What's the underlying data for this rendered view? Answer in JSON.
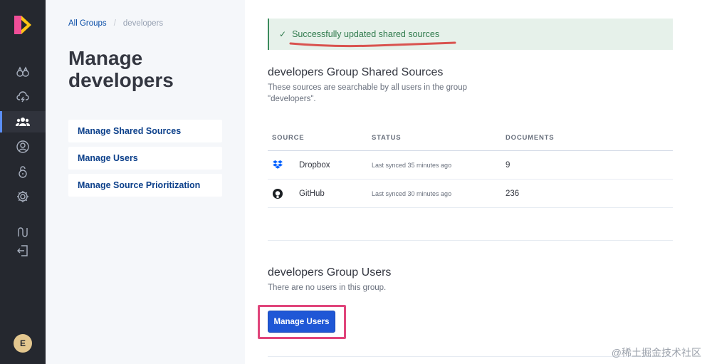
{
  "rail": {
    "icons": [
      "binoculars-icon",
      "cloud-lightning-icon",
      "users-icon",
      "user-circle-icon",
      "lock-icon",
      "gear-icon",
      "chart-path-icon",
      "logout-icon"
    ],
    "avatar_initial": "E",
    "accent_color": "#5b8ff9"
  },
  "breadcrumb": {
    "root": "All Groups",
    "separator": "/",
    "current": "developers"
  },
  "page_title": "Manage developers",
  "side_nav": [
    {
      "label": "Manage Shared Sources"
    },
    {
      "label": "Manage Users"
    },
    {
      "label": "Manage Source Prioritization"
    }
  ],
  "toast": {
    "message": "Successfully updated shared sources",
    "color": "#2f7a4c"
  },
  "shared_sources": {
    "title": "developers Group Shared Sources",
    "description": "These sources are searchable by all users in the group \"developers\".",
    "columns": [
      "SOURCE",
      "STATUS",
      "DOCUMENTS"
    ],
    "rows": [
      {
        "icon": "dropbox-icon",
        "source": "Dropbox",
        "status": "Last synced 35 minutes ago",
        "documents": "9"
      },
      {
        "icon": "github-icon",
        "source": "GitHub",
        "status": "Last synced 30 minutes ago",
        "documents": "236"
      }
    ]
  },
  "group_users": {
    "title": "developers Group Users",
    "description": "There are no users in this group.",
    "button_label": "Manage Users",
    "button_color": "#1f57d6"
  },
  "watermark": "@稀土掘金技术社区"
}
